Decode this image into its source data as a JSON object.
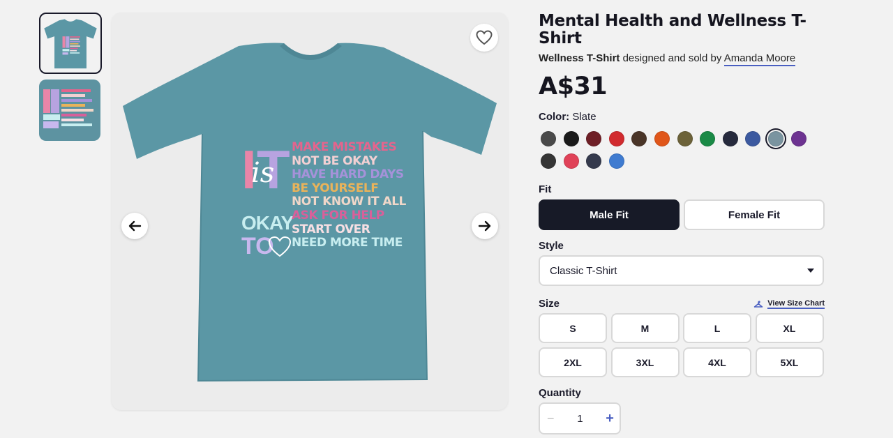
{
  "gallery": {
    "favorite_icon": "heart-outline-icon",
    "prev_icon": "arrow-left-icon",
    "next_icon": "arrow-right-icon",
    "shirt_color": "#5b97a5",
    "design": {
      "big_letters": [
        "I",
        "T",
        "is",
        "OKAY",
        "TO"
      ],
      "lines": [
        {
          "text": "MAKE MISTAKES",
          "color": "#e5648d"
        },
        {
          "text": "NOT BE OKAY",
          "color": "#f3d0d3"
        },
        {
          "text": "HAVE HARD DAYS",
          "color": "#a592d9"
        },
        {
          "text": "BE YOURSELF",
          "color": "#e9b35a"
        },
        {
          "text": "NOT KNOW IT ALL",
          "color": "#f0d7c9"
        },
        {
          "text": "ASK FOR HELP",
          "color": "#d8609a"
        },
        {
          "text": "START OVER",
          "color": "#f7dfe3"
        },
        {
          "text": "NEED MORE TIME",
          "color": "#c8eef0"
        }
      ]
    }
  },
  "product": {
    "title": "Mental Health and Wellness T-Shirt",
    "product_type": "Wellness T-Shirt",
    "designed_by_text": "designed and sold by",
    "artist": "Amanda Moore",
    "price": "A$31"
  },
  "color": {
    "label": "Color:",
    "selected": "Slate",
    "swatches": [
      "#4a4a4a",
      "#1a1a1a",
      "#6e1f26",
      "#d12a2e",
      "#4a3528",
      "#e0561a",
      "#6c6239",
      "#1a8a46",
      "#262a3d",
      "#3c5aa0",
      "#7a94a0",
      "#6d3391",
      "#353535",
      "#e04258",
      "#353a4d",
      "#3f7bd0"
    ],
    "selected_index": 10
  },
  "fit": {
    "label": "Fit",
    "options": [
      "Male Fit",
      "Female Fit"
    ]
  },
  "style": {
    "label": "Style",
    "value": "Classic T-Shirt"
  },
  "size": {
    "label": "Size",
    "chart_link": "View Size Chart",
    "chart_icon": "hanger-icon",
    "options": [
      "S",
      "M",
      "L",
      "XL",
      "2XL",
      "3XL",
      "4XL",
      "5XL"
    ]
  },
  "quantity": {
    "label": "Quantity",
    "value": "1",
    "minus": "−",
    "plus": "+"
  }
}
